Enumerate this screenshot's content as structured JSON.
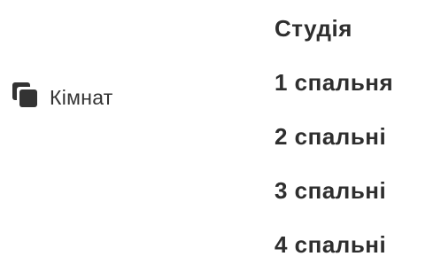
{
  "filter": {
    "icon": "rooms-icon",
    "label": "Кімнат"
  },
  "options": [
    {
      "label": "Студія"
    },
    {
      "label": "1 спальня"
    },
    {
      "label": "2 спальні"
    },
    {
      "label": "3 спальні"
    },
    {
      "label": "4 спальні"
    }
  ],
  "colors": {
    "text": "#333333",
    "option_text": "#2e2e2e",
    "background": "#ffffff"
  }
}
